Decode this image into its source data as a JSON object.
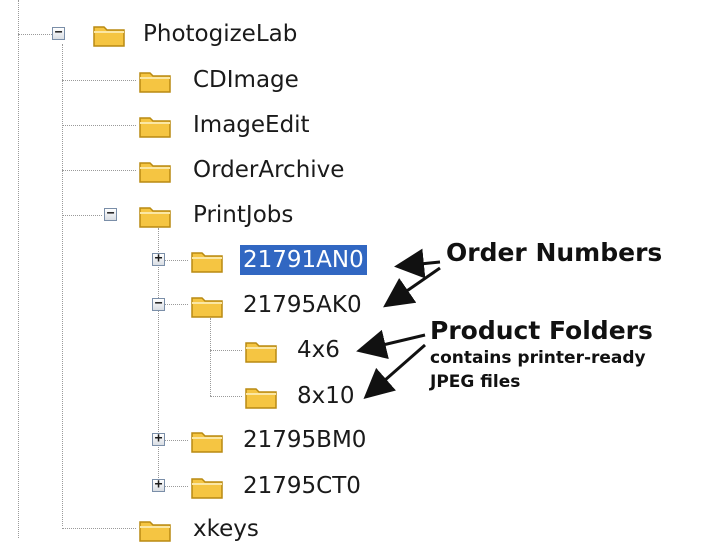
{
  "tree": {
    "nodes": [
      {
        "id": "photogizelab",
        "label": "PhotogizeLab",
        "expander": "−",
        "selected": false
      },
      {
        "id": "cdimage",
        "label": "CDImage",
        "expander": "",
        "selected": false
      },
      {
        "id": "imageedit",
        "label": "ImageEdit",
        "expander": "",
        "selected": false
      },
      {
        "id": "orderarchive",
        "label": "OrderArchive",
        "expander": "",
        "selected": false
      },
      {
        "id": "printjobs",
        "label": "PrintJobs",
        "expander": "−",
        "selected": false
      },
      {
        "id": "21791an0",
        "label": "21791AN0",
        "expander": "+",
        "selected": true
      },
      {
        "id": "21795ak0",
        "label": "21795AK0",
        "expander": "−",
        "selected": false
      },
      {
        "id": "4x6",
        "label": "4x6",
        "expander": "",
        "selected": false
      },
      {
        "id": "8x10",
        "label": "8x10",
        "expander": "",
        "selected": false
      },
      {
        "id": "21795bm0",
        "label": "21795BM0",
        "expander": "+",
        "selected": false
      },
      {
        "id": "21795ct0",
        "label": "21795CT0",
        "expander": "+",
        "selected": false
      },
      {
        "id": "xkeys",
        "label": "xkeys",
        "expander": "",
        "selected": false
      }
    ]
  },
  "annotations": {
    "order_numbers": "Order Numbers",
    "product_folders": "Product Folders",
    "product_note_line1": "contains printer-ready",
    "product_note_line2": "JPEG files"
  },
  "colors": {
    "selection": "#3167c2",
    "folder_fill": "#f5c542",
    "folder_edge": "#b98a12",
    "tree_lines": "#9a9a9a"
  }
}
